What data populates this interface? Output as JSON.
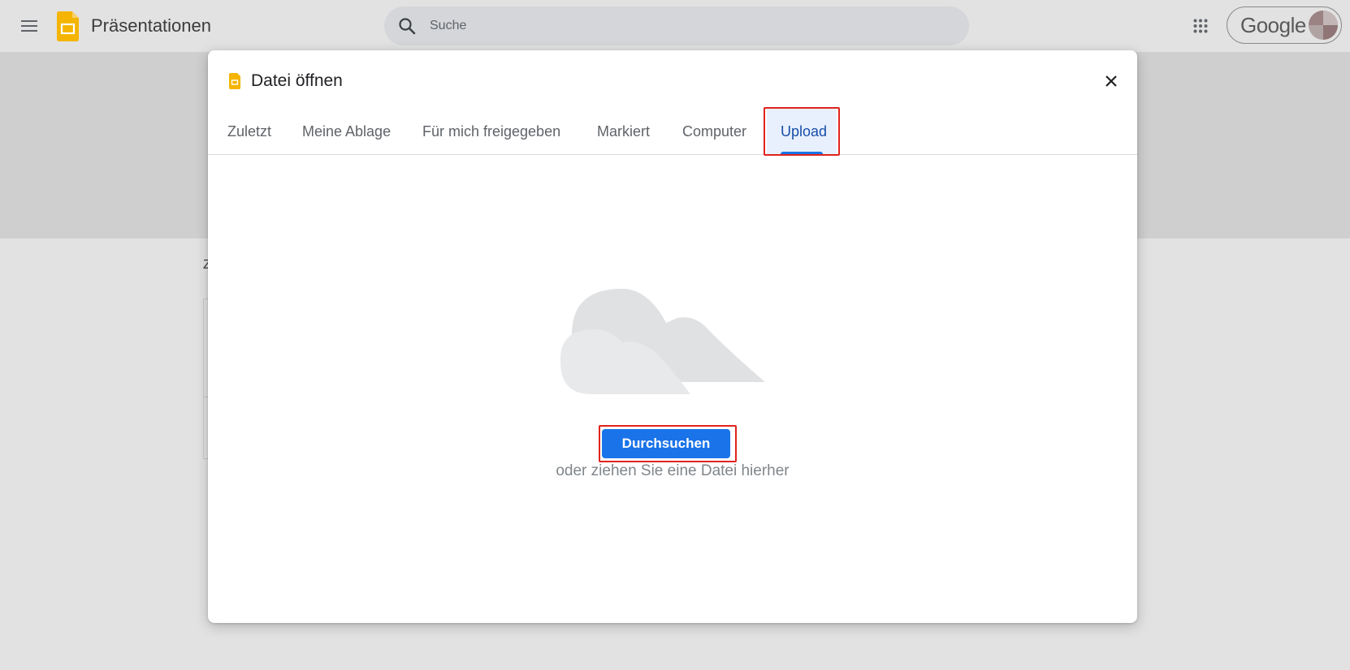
{
  "app": {
    "title": "Präsentationen",
    "menu_icon": "hamburger-menu-icon",
    "logo_icon": "slides-logo-icon",
    "logo_color": "#f4b400"
  },
  "search": {
    "placeholder": "Suche",
    "icon": "search-icon"
  },
  "header_right": {
    "apps_icon": "apps-grid-icon",
    "account_label": "Google"
  },
  "background": {
    "partial_text": "Z"
  },
  "dialog": {
    "title": "Datei öffnen",
    "title_icon": "slides-file-icon",
    "close_icon": "close-icon",
    "tabs": [
      {
        "label": "Zuletzt",
        "active": false
      },
      {
        "label": "Meine Ablage",
        "active": false
      },
      {
        "label": "Für mich freigegeben",
        "active": false
      },
      {
        "label": "Markiert",
        "active": false
      },
      {
        "label": "Computer",
        "active": false
      },
      {
        "label": "Upload",
        "active": true
      }
    ],
    "upload": {
      "illustration": "cloud-illustration",
      "browse_label": "Durchsuchen",
      "drop_hint": "oder ziehen Sie eine Datei hierher"
    }
  },
  "colors": {
    "accent": "#1a73e8",
    "active_tab_text": "#174ea6",
    "active_tab_bg": "#e8f0fe",
    "highlight_box": "#e0231c"
  }
}
